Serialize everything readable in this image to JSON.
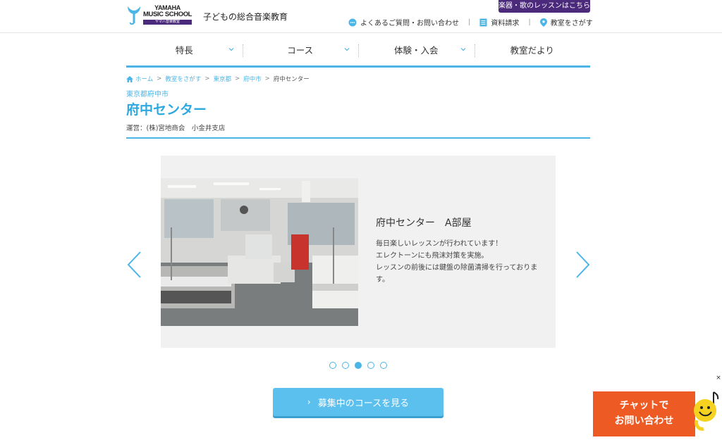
{
  "header": {
    "logo_line1": "YAMAHA",
    "logo_line2": "MUSIC SCHOOL",
    "logo_sub": "ヤマハ音楽教室",
    "tagline": "子どもの総合音楽教育",
    "top_button": "楽器・歌のレッスンはこちら",
    "utils": [
      {
        "label": "よくあるご質問・お問い合わせ",
        "icon": "chat-bubble-icon"
      },
      {
        "label": "資料請求",
        "icon": "document-icon"
      },
      {
        "label": "教室をさがす",
        "icon": "location-pin-icon"
      }
    ]
  },
  "nav": [
    {
      "label": "特長",
      "has_dropdown": true
    },
    {
      "label": "コース",
      "has_dropdown": true
    },
    {
      "label": "体験・入会",
      "has_dropdown": true
    },
    {
      "label": "教室だより",
      "has_dropdown": false
    }
  ],
  "breadcrumb": [
    "ホーム",
    "教室をさがす",
    "東京都",
    "府中市",
    "府中センター"
  ],
  "page": {
    "prefecture": "東京都府中市",
    "title": "府中センター",
    "operator": "運営：(株)宮地商会　小金井支店"
  },
  "slider": {
    "title": "府中センター　A部屋",
    "desc": [
      "毎日楽しいレッスンが行われています！",
      "エレクトーンにも飛沫対策を実施。",
      "レッスンの前後には鍵盤の除菌清掃を行っておりま",
      "す。"
    ],
    "dot_count": 5,
    "active_dot": 3
  },
  "cta": {
    "label": "募集中のコースを見る"
  },
  "chat": {
    "line1": "チャットで",
    "line2": "お問い合わせ",
    "close": "×"
  },
  "colors": {
    "accent": "#4cb5e8",
    "brand_purple": "#4b2a7c",
    "chat_orange": "#ee5a24"
  }
}
